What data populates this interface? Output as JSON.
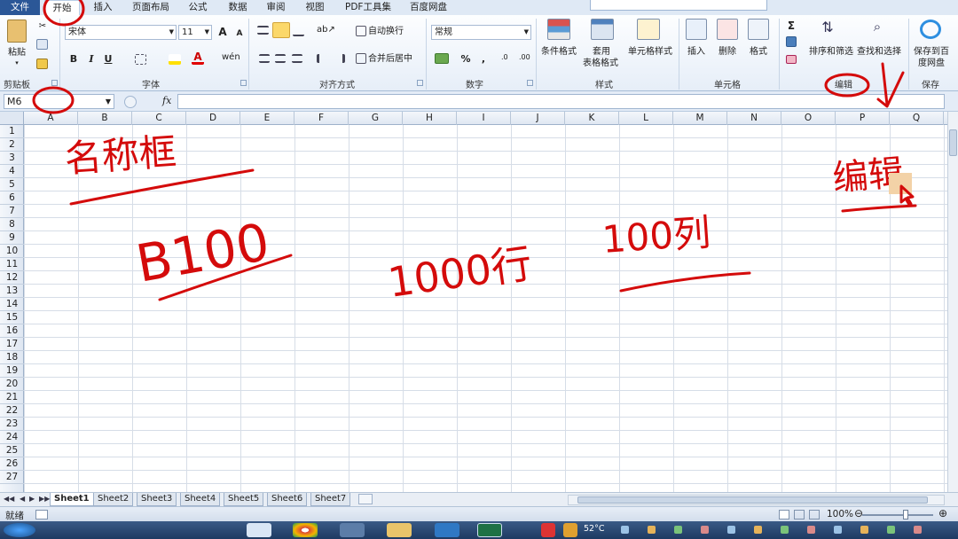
{
  "tabs": {
    "file": "文件",
    "home": "开始",
    "insert": "插入",
    "layout": "页面布局",
    "formulas": "公式",
    "data": "数据",
    "review": "审阅",
    "view": "视图",
    "pdf": "PDF工具集",
    "baidu": "百度网盘"
  },
  "ribbon": {
    "clipboard": {
      "paste": "粘贴",
      "label": "剪贴板"
    },
    "font": {
      "name": "宋体",
      "size": "11",
      "bold": "B",
      "italic": "I",
      "underline": "U",
      "grow": "A",
      "shrink": "A",
      "label": "字体"
    },
    "alignment": {
      "wrap": "自动换行",
      "merge": "合并后居中",
      "label": "对齐方式"
    },
    "number": {
      "format": "常规",
      "percent": "%",
      "comma": ",",
      "label": "数字"
    },
    "styles": {
      "conditional": "条件格式",
      "table_a": "套用",
      "table_b": "表格格式",
      "cell_styles": "单元格样式",
      "label": "样式"
    },
    "cells": {
      "insert": "插入",
      "delete": "删除",
      "format": "格式",
      "label": "单元格"
    },
    "editing": {
      "sum": "Σ",
      "sort": "排序和筛选",
      "find": "查找和选择",
      "label": "编辑"
    },
    "save": {
      "button_a": "保存到百",
      "button_b": "度网盘",
      "label": "保存"
    }
  },
  "formula_bar": {
    "name_box": "M6",
    "fx": "fx",
    "content": ""
  },
  "grid": {
    "columns": [
      "A",
      "B",
      "C",
      "D",
      "E",
      "F",
      "G",
      "H",
      "I",
      "J",
      "K",
      "L",
      "M",
      "N",
      "O",
      "P",
      "Q"
    ],
    "rows": [
      "1",
      "2",
      "3",
      "4",
      "5",
      "6",
      "7",
      "8",
      "9",
      "10",
      "11",
      "12",
      "13",
      "14",
      "15",
      "16",
      "17",
      "18",
      "19",
      "20",
      "21",
      "22",
      "23",
      "24",
      "25",
      "26",
      "27"
    ]
  },
  "sheets": [
    "Sheet1",
    "Sheet2",
    "Sheet3",
    "Sheet4",
    "Sheet5",
    "Sheet6",
    "Sheet7"
  ],
  "status": {
    "ready": "就绪",
    "zoom": "100%"
  },
  "taskbar": {
    "temperature": "52°C"
  },
  "annotations": {
    "name_box_text": "名称框",
    "cell_ref": "B100",
    "rows_note": "1000行",
    "cols_note": "100列",
    "editing_note": "编辑"
  },
  "colors": {
    "ink": "#d40b0b",
    "file_tab": "#2b5797",
    "ribbon_bg": "#e6eef8"
  }
}
